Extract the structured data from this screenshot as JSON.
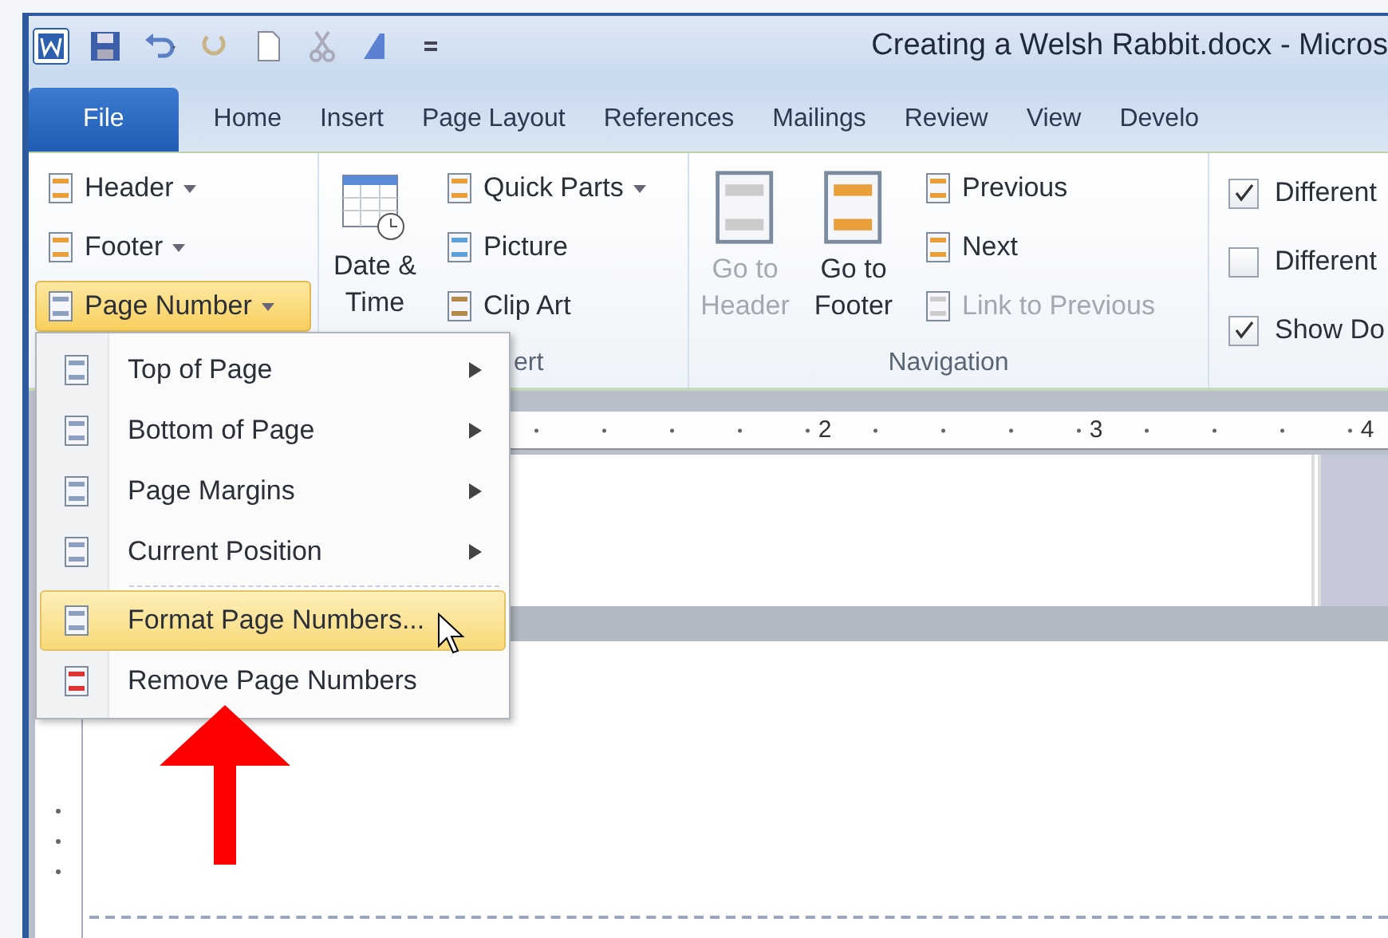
{
  "window": {
    "title": "Creating a Welsh Rabbit.docx  -  Micros"
  },
  "tabs": [
    {
      "label": "File",
      "kind": "file",
      "selected": false
    },
    {
      "label": "Home",
      "kind": "tab",
      "selected": false
    },
    {
      "label": "Insert",
      "kind": "tab",
      "selected": false
    },
    {
      "label": "Page Layout",
      "kind": "tab",
      "selected": false
    },
    {
      "label": "References",
      "kind": "tab",
      "selected": false
    },
    {
      "label": "Mailings",
      "kind": "tab",
      "selected": false
    },
    {
      "label": "Review",
      "kind": "tab",
      "selected": false
    },
    {
      "label": "View",
      "kind": "tab",
      "selected": false
    },
    {
      "label": "Develo",
      "kind": "tab",
      "selected": false
    }
  ],
  "header_footer_group": {
    "buttons": [
      {
        "label": "Header",
        "selected": false
      },
      {
        "label": "Footer",
        "selected": false
      },
      {
        "label": "Page Number",
        "selected": true
      }
    ]
  },
  "insert_group": {
    "date_time": "Date & Time",
    "items": [
      {
        "label": "Quick Parts",
        "dropdown": true
      },
      {
        "label": "Picture",
        "dropdown": false
      },
      {
        "label": "Clip Art",
        "dropdown": false
      }
    ],
    "label": "ert"
  },
  "navigation_group": {
    "large_buttons": [
      {
        "label": "Go to Header",
        "disabled": true
      },
      {
        "label": "Go to Footer",
        "disabled": false
      }
    ],
    "small_buttons": [
      {
        "label": "Previous",
        "disabled": false
      },
      {
        "label": "Next",
        "disabled": false
      },
      {
        "label": "Link to Previous",
        "disabled": true
      }
    ],
    "label": "Navigation"
  },
  "options_group": {
    "checkboxes": [
      {
        "label": "Different",
        "checked": true
      },
      {
        "label": "Different",
        "checked": false
      },
      {
        "label": "Show Do",
        "checked": true
      }
    ]
  },
  "ruler": {
    "numbers": [
      "2",
      "3",
      "4"
    ]
  },
  "page_number_menu": {
    "items": [
      {
        "label": "Top of Page",
        "submenu": true,
        "separator_before": false,
        "selected": false
      },
      {
        "label": "Bottom of Page",
        "submenu": true,
        "separator_before": false,
        "selected": false
      },
      {
        "label": "Page Margins",
        "submenu": true,
        "separator_before": false,
        "selected": false
      },
      {
        "label": "Current Position",
        "submenu": true,
        "separator_before": false,
        "selected": false
      },
      {
        "label": "Format Page Numbers...",
        "submenu": false,
        "separator_before": true,
        "selected": true
      },
      {
        "label": "Remove Page Numbers",
        "submenu": false,
        "separator_before": false,
        "selected": false
      }
    ]
  }
}
